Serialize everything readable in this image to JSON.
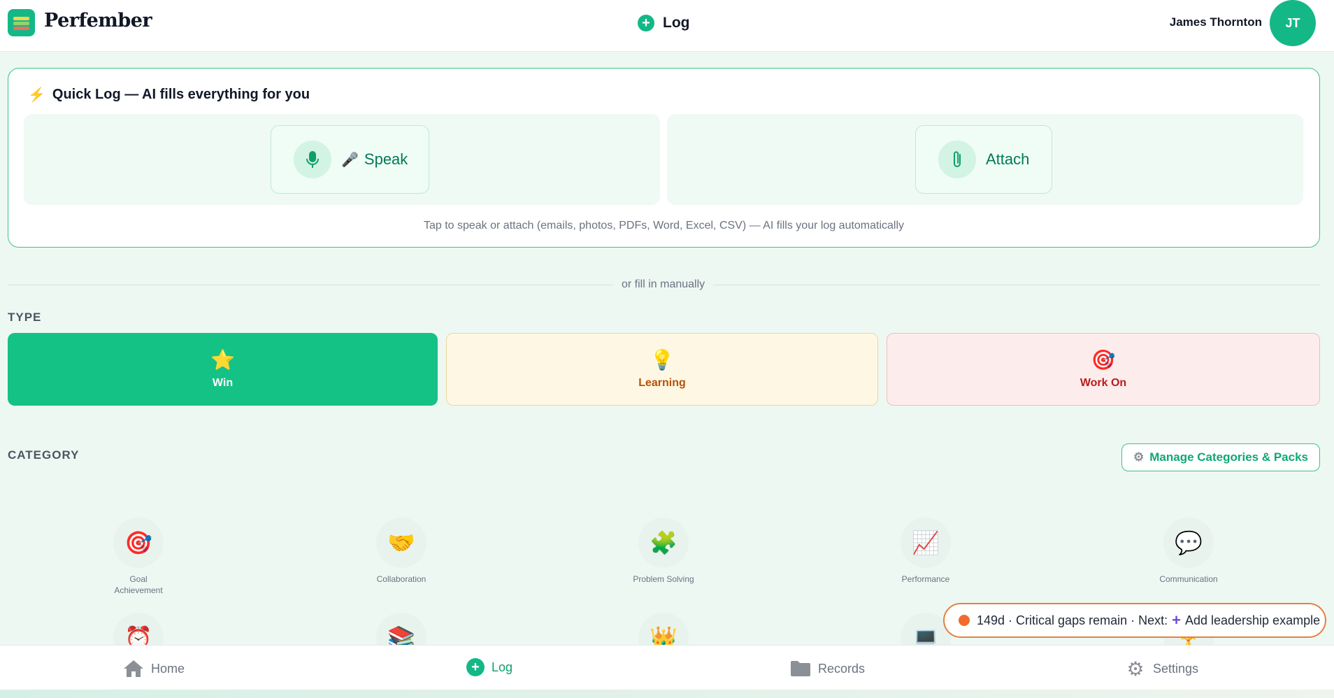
{
  "header": {
    "brand": "Perfember",
    "log_label": "Log",
    "user_name": "James Thornton",
    "avatar_initials": "JT"
  },
  "quick_log": {
    "title": "Quick Log — AI fills everything for you",
    "speak_label": "Speak",
    "attach_label": "Attach",
    "hint": "Tap to speak or attach (emails, photos, PDFs, Word, Excel, CSV) — AI fills your log automatically"
  },
  "divider_text": "or fill in manually",
  "type_section": {
    "label": "TYPE",
    "types": [
      {
        "label": "Win",
        "emoji": "⭐"
      },
      {
        "label": "Learning",
        "emoji": "💡"
      },
      {
        "label": "Work On",
        "emoji": "🎯"
      }
    ]
  },
  "category_section": {
    "label": "CATEGORY",
    "manage_label": "Manage Categories & Packs",
    "categories": [
      {
        "label": "Goal Achievement",
        "emoji": "🎯"
      },
      {
        "label": "Collaboration",
        "emoji": "🤝"
      },
      {
        "label": "Problem Solving",
        "emoji": "🧩"
      },
      {
        "label": "Performance",
        "emoji": "📈"
      },
      {
        "label": "Communication",
        "emoji": "💬"
      }
    ],
    "row2_emojis": [
      "⏰",
      "📚",
      "👑",
      "💻",
      "🏆"
    ]
  },
  "status_pill": {
    "text": "149d · Critical gaps remain · Next:",
    "action": "Add leadership example"
  },
  "bottom_nav": {
    "home": "Home",
    "log": "Log",
    "records": "Records",
    "settings": "Settings"
  },
  "colors": {
    "accent": "#14b887",
    "win": "#14c285",
    "learning_bg": "#fef7e3",
    "work_on_bg": "#fdecec",
    "warning": "#e3813f"
  }
}
